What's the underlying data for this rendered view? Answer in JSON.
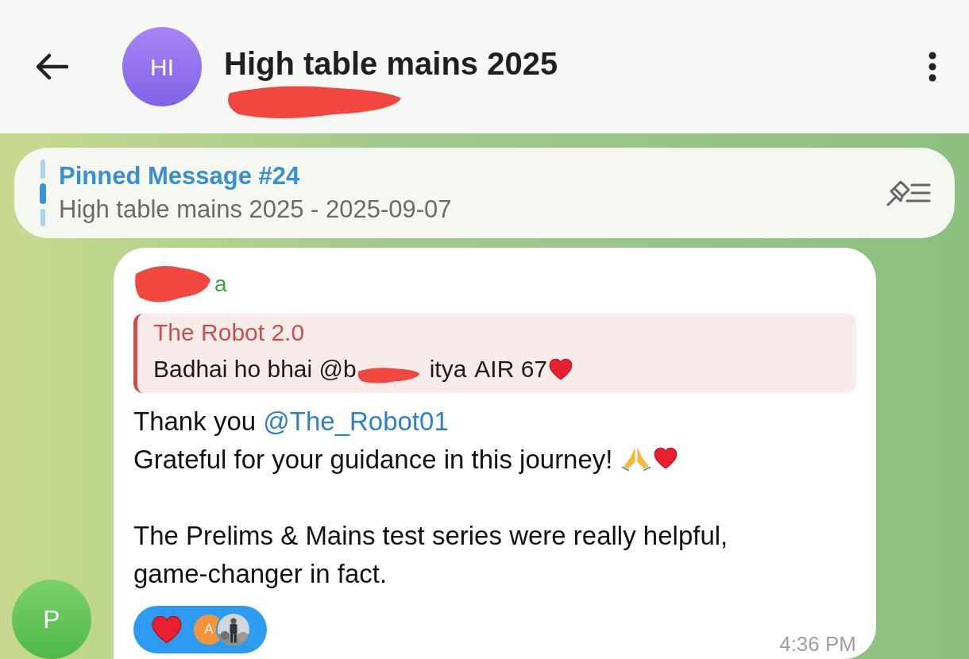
{
  "header": {
    "avatar_initials": "HI",
    "title": "High table mains 2025",
    "subtitle_redacted": true
  },
  "pinned": {
    "title": "Pinned Message #24",
    "text": "High table mains 2025 - 2025-09-07"
  },
  "message": {
    "sender": "a",
    "sender_redacted": true,
    "reply": {
      "author": "The Robot 2.0",
      "parts": [
        {
          "kind": "text",
          "text": "Badhai ho bhai @b"
        },
        {
          "kind": "redaction"
        },
        {
          "kind": "text",
          "text": "itya"
        },
        {
          "kind": "text",
          "text": "AIR 67"
        },
        {
          "kind": "heart"
        }
      ]
    },
    "paragraphs": [
      [
        [
          {
            "kind": "text",
            "text": "Thank you "
          },
          {
            "kind": "mention",
            "text": "@The_Robot01"
          }
        ],
        [
          {
            "kind": "text",
            "text": "Grateful for your guidance in this journey! "
          },
          {
            "kind": "pray"
          },
          {
            "kind": "heart"
          }
        ]
      ],
      [
        [
          {
            "kind": "text",
            "text": "The Prelims & Mains test series were really helpful, game-changer in fact."
          }
        ]
      ]
    ],
    "reactions": [
      {
        "kind": "heart",
        "avatars": [
          {
            "kind": "letter",
            "letter": "A",
            "color": "#f3953a"
          },
          {
            "kind": "picture"
          }
        ]
      }
    ],
    "time": "4:36 PM"
  },
  "sender_avatar": {
    "letter": "P"
  }
}
